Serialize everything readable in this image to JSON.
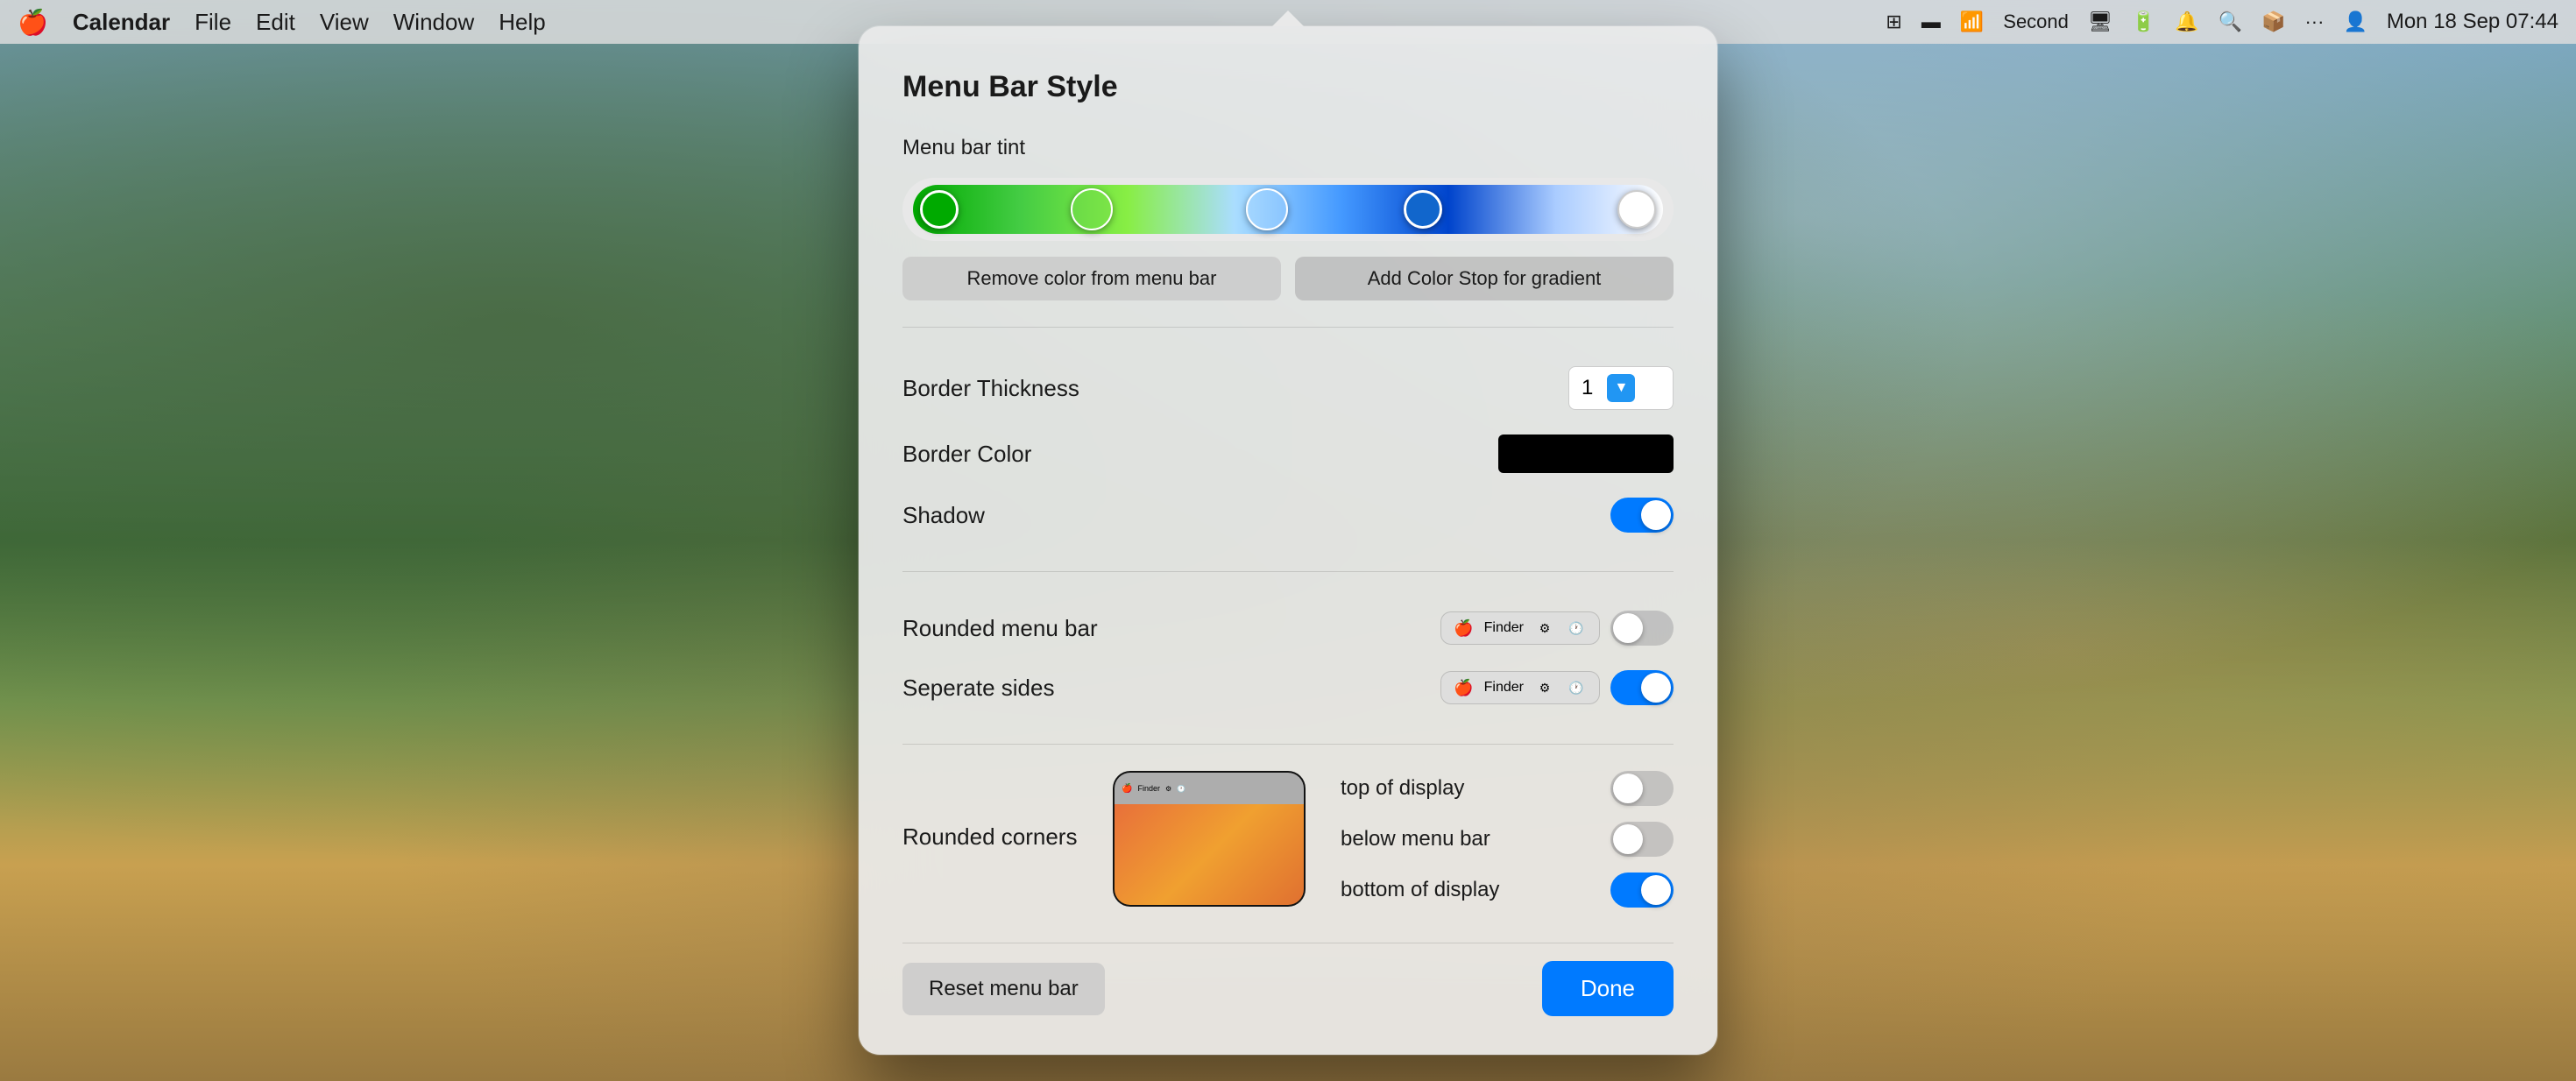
{
  "menubar": {
    "apple_symbol": "🍎",
    "app_name": "Calendar",
    "menus": [
      "File",
      "Edit",
      "View",
      "Window",
      "Help"
    ],
    "right_items": [
      "⊞",
      "▬",
      "WiFi",
      "Second",
      "🖥",
      "🔋",
      "🔔",
      "🔍",
      "Dropbox",
      "···",
      "👤"
    ],
    "date_time": "Mon 18 Sep  07:44"
  },
  "dialog": {
    "title": "Menu Bar Style",
    "tint_section": {
      "label": "Menu bar tint",
      "remove_btn": "Remove color from menu bar",
      "add_btn": "Add Color Stop for gradient"
    },
    "border_thickness": {
      "label": "Border Thickness",
      "value": "1"
    },
    "border_color": {
      "label": "Border Color"
    },
    "shadow": {
      "label": "Shadow",
      "enabled": true
    },
    "rounded_menu_bar": {
      "label": "Rounded menu bar",
      "enabled": false
    },
    "separate_sides": {
      "label": "Seperate sides",
      "enabled": true
    },
    "rounded_corners": {
      "label": "Rounded corners",
      "top_label": "top of display",
      "below_label": "below menu bar",
      "bottom_label": "bottom of display",
      "top_enabled": false,
      "below_enabled": false,
      "bottom_enabled": true
    },
    "footer": {
      "reset_label": "Reset menu bar",
      "done_label": "Done"
    }
  }
}
